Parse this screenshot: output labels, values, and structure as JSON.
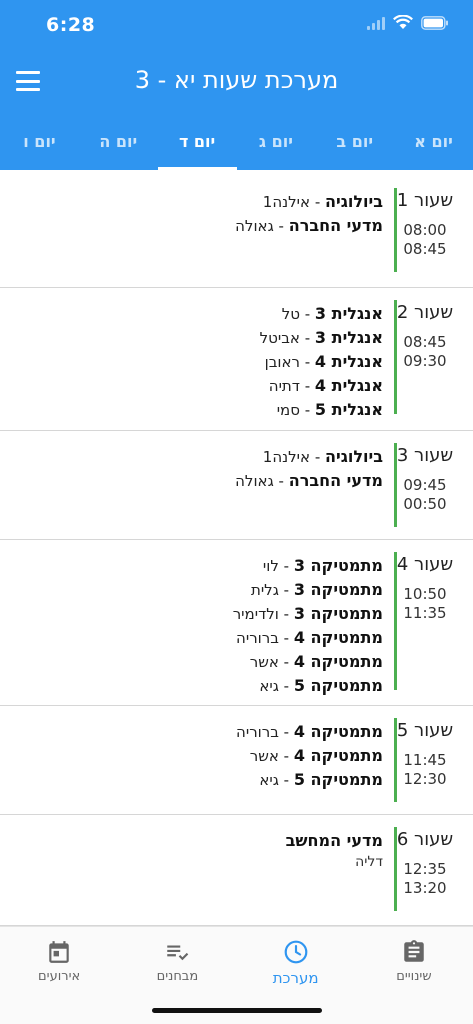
{
  "status_bar": {
    "time": "6:28"
  },
  "header": {
    "title": "מערכת שעות   יא - 3"
  },
  "tabs": [
    {
      "label": "יום א",
      "active": false
    },
    {
      "label": "יום ב",
      "active": false
    },
    {
      "label": "יום ג",
      "active": false
    },
    {
      "label": "יום ד",
      "active": true
    },
    {
      "label": "יום ה",
      "active": false
    },
    {
      "label": "יום ו",
      "active": false
    }
  ],
  "periods": [
    {
      "label": "שעור 1",
      "start": "08:00",
      "end": "08:45",
      "lessons": [
        {
          "subject": "ביולוגיה",
          "teacher": " - אילנה1"
        },
        {
          "subject": "מדעי החברה",
          "teacher": " - גאולה"
        }
      ]
    },
    {
      "label": "שעור 2",
      "start": "08:45",
      "end": "09:30",
      "lessons": [
        {
          "subject": "אנגלית 3",
          "teacher": " - טל"
        },
        {
          "subject": "אנגלית 3",
          "teacher": " - אביטל"
        },
        {
          "subject": "אנגלית 4",
          "teacher": " - ראובן"
        },
        {
          "subject": "אנגלית 4",
          "teacher": " - דתיה"
        },
        {
          "subject": "אנגלית 5",
          "teacher": " - סמי"
        }
      ]
    },
    {
      "label": "שעור 3",
      "start": "09:45",
      "end": "00:50",
      "lessons": [
        {
          "subject": "ביולוגיה",
          "teacher": " - אילנה1"
        },
        {
          "subject": "מדעי החברה",
          "teacher": " - גאולה"
        }
      ]
    },
    {
      "label": "שעור 4",
      "start": "10:50",
      "end": "11:35",
      "lessons": [
        {
          "subject": "מתמטיקה 3",
          "teacher": " - לוי"
        },
        {
          "subject": "מתמטיקה 3",
          "teacher": " - גלית"
        },
        {
          "subject": "מתמטיקה 3",
          "teacher": " - ולדימיר"
        },
        {
          "subject": "מתמטיקה 4",
          "teacher": " - ברוריה"
        },
        {
          "subject": "מתמטיקה 4",
          "teacher": " - אשר"
        },
        {
          "subject": "מתמטיקה 5",
          "teacher": " - גיא"
        }
      ]
    },
    {
      "label": "שעור 5",
      "start": "11:45",
      "end": "12:30",
      "lessons": [
        {
          "subject": "מתמטיקה 4",
          "teacher": " - ברוריה"
        },
        {
          "subject": "מתמטיקה 4",
          "teacher": " - אשר"
        },
        {
          "subject": "מתמטיקה 5",
          "teacher": " - גיא"
        }
      ]
    },
    {
      "label": "שעור 6",
      "start": "12:35",
      "end": "13:20",
      "lessons": [
        {
          "subject": "מדעי המחשב",
          "teacher_below": "דליה"
        }
      ]
    }
  ],
  "bottom_nav": [
    {
      "label": "שינויים",
      "icon": "clipboard-icon",
      "active": false
    },
    {
      "label": "מערכת",
      "icon": "clock-icon",
      "active": true
    },
    {
      "label": "מבחנים",
      "icon": "checklist-icon",
      "active": false
    },
    {
      "label": "אירועים",
      "icon": "calendar-icon",
      "active": false
    }
  ],
  "colors": {
    "primary": "#2f95f0",
    "accent_bar": "#4caf50"
  }
}
